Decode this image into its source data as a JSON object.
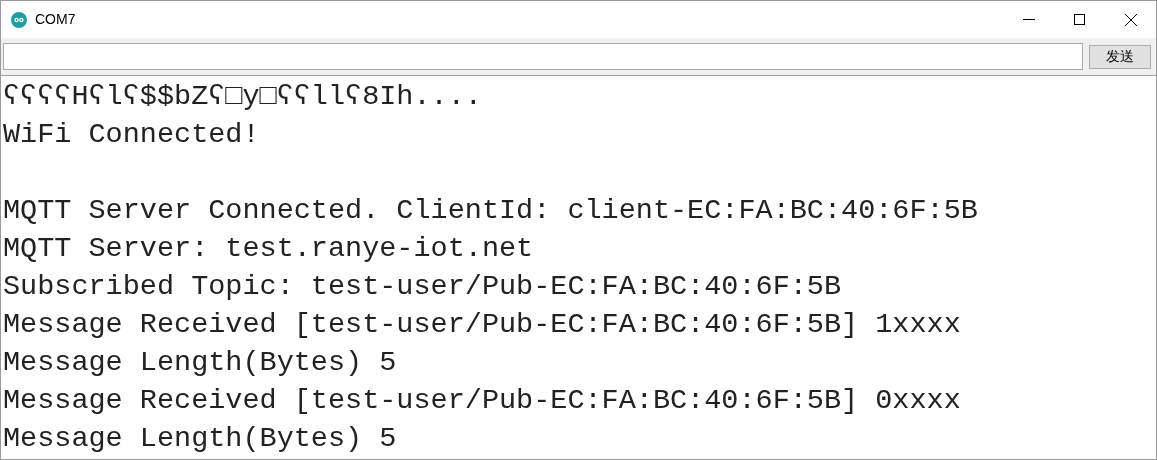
{
  "window": {
    "title": "COM7"
  },
  "send_button": {
    "label": "发送"
  },
  "output": [
    {
      "text": "ʕʕʕʕHʕlʕ$$bZʕ□y□ʕʕllʕ8Ih....",
      "blank_before": false
    },
    {
      "text": "WiFi Connected!",
      "blank_before": false
    },
    {
      "text": "MQTT Server Connected. ClientId: client-EC:FA:BC:40:6F:5B",
      "blank_before": true
    },
    {
      "text": "MQTT Server: test.ranye-iot.net",
      "blank_before": false
    },
    {
      "text": "Subscribed Topic: test-user/Pub-EC:FA:BC:40:6F:5B",
      "blank_before": false
    },
    {
      "text": "Message Received [test-user/Pub-EC:FA:BC:40:6F:5B] 1xxxx",
      "blank_before": false
    },
    {
      "text": "Message Length(Bytes) 5",
      "blank_before": false
    },
    {
      "text": "Message Received [test-user/Pub-EC:FA:BC:40:6F:5B] 0xxxx",
      "blank_before": false
    },
    {
      "text": "Message Length(Bytes) 5",
      "blank_before": false
    }
  ]
}
